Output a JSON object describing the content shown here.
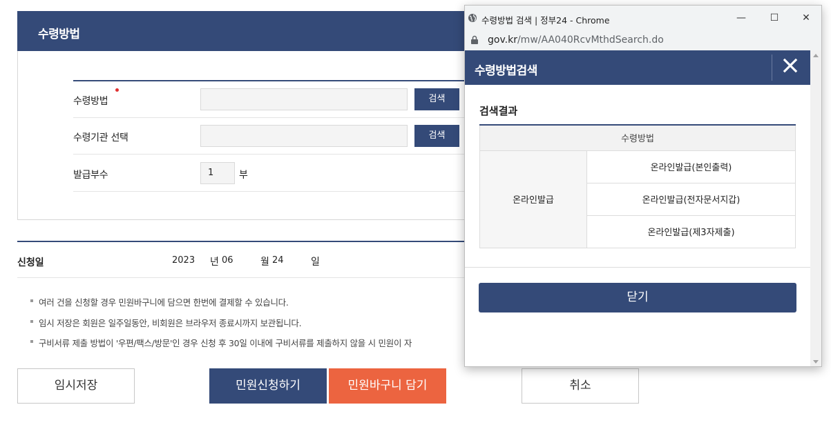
{
  "page": {
    "section_title": "수령방법",
    "form": {
      "method_label": "수령방법",
      "method_search_btn": "검색",
      "agency_label": "수령기관 선택",
      "agency_search_btn": "검색",
      "copies_label": "발급부수",
      "copies_value": "1",
      "copies_unit": "부"
    },
    "date": {
      "label": "신청일",
      "year": "2023",
      "year_unit": "년",
      "month": "06",
      "month_unit": "월",
      "day": "24",
      "day_unit": "일"
    },
    "notes": [
      "여러 건을 신청할 경우 민원바구니에 담으면 한번에 결제할 수 있습니다.",
      "임시 저장은 회원은 일주일동안, 비회원은 브라우저 종료시까지 보관됩니다.",
      "구비서류 제출 방법이 '우편/팩스/방문'인 경우 신청 후 30일 이내에 구비서류를 제출하지 않을 시 민원이 자"
    ],
    "buttons": {
      "temp_save": "임시저장",
      "apply": "민원신청하기",
      "basket": "민원바구니 담기",
      "cancel": "취소"
    }
  },
  "popup": {
    "window_title": "수령방법 검색 | 정부24 - Chrome",
    "url_domain": "gov.kr",
    "url_path": "/mw/AA040RcvMthdSearch.do",
    "header_title": "수령방법검색",
    "result_title": "검색결과",
    "table": {
      "header": "수령방법",
      "group": "온라인발급",
      "options": [
        "온라인발급(본인출력)",
        "온라인발급(전자문서지갑)",
        "온라인발급(제3자제출)"
      ]
    },
    "close_button": "닫기"
  },
  "colors": {
    "primary": "#344a78",
    "accent": "#ec6440",
    "required": "#e03131"
  },
  "icons": {
    "window_icon": "globe-icon",
    "secure_icon": "lock-icon",
    "close_icon": "close-x-icon"
  }
}
